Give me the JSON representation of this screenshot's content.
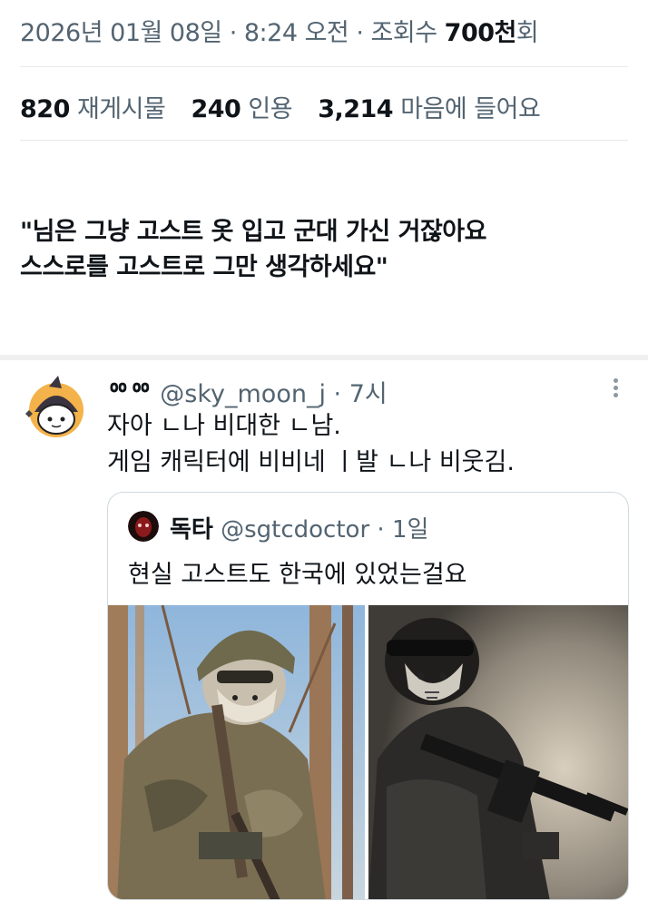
{
  "meta": {
    "date": "2026년 01월 08일",
    "time": "8:24 오전",
    "views_label": "조회수",
    "views_count": "700천",
    "views_suffix": "회"
  },
  "stats": [
    {
      "number": "820",
      "label": "재게시물"
    },
    {
      "number": "240",
      "label": "인용"
    },
    {
      "number": "3,214",
      "label": "마음에 들어요"
    }
  ],
  "caption": {
    "line1": "\"님은 그냥 고스트 옷 입고 군대 가신 거잖아요",
    "line2": "스스로를 고스트로 그만 생각하세요\""
  },
  "tweet": {
    "display_name": "ᅇᅇ",
    "handle": "@sky_moon_j",
    "time": "7시",
    "line1": "자아 ㄴ나 비대한 ㄴ남.",
    "line2": "게임 캐릭터에 비비네 ㅣ발 ㄴ나 비웃김."
  },
  "quote": {
    "display_name": "독타",
    "handle": "@sgtcdoctor",
    "time": "1일",
    "text": "현실 고스트도 한국에 있었는걸요"
  },
  "colors": {
    "text_primary": "#0f1419",
    "text_secondary": "#536471",
    "border": "#cfd9de",
    "divider": "#e7e9ea"
  },
  "icons": {
    "avatar": "witch-hat-ghost-avatar",
    "more": "more-vertical-icon",
    "quote_avatar": "red-mask-avatar"
  }
}
